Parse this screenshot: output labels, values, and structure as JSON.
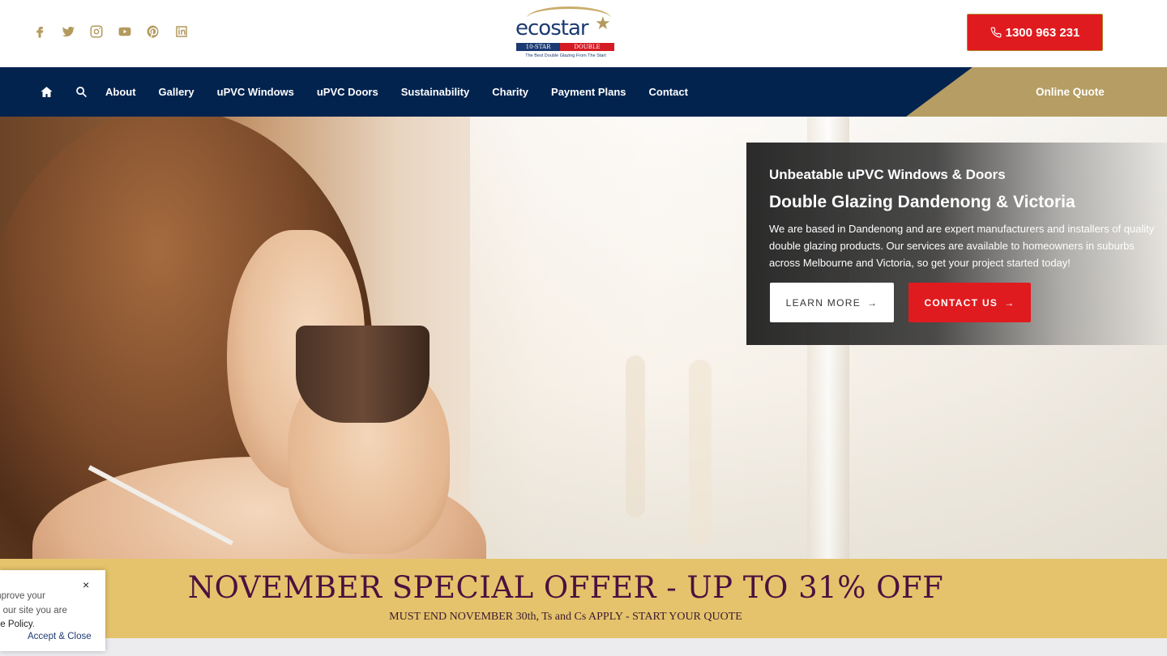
{
  "header": {
    "social": [
      "facebook-icon",
      "twitter-icon",
      "instagram-icon",
      "youtube-icon",
      "pinterest-icon",
      "linkedin-icon"
    ],
    "logo": {
      "brand": "ecostar",
      "band_left": "10-STAR",
      "band_right": "DOUBLE GLAZING",
      "tagline": "The Best Double Glazing From The Start"
    },
    "phone": "1300 963 231"
  },
  "nav": {
    "items": [
      "About",
      "Gallery",
      "uPVC Windows",
      "uPVC Doors",
      "Sustainability",
      "Charity",
      "Payment Plans",
      "Contact"
    ],
    "quote": "Online Quote"
  },
  "hero": {
    "subtitle": "Unbeatable uPVC Windows & Doors",
    "title": "Double Glazing Dandenong & Victoria",
    "description": "We are based in Dandenong and are expert manufacturers and installers of quality double glazing products. Our services are available to homeowners in suburbs across Melbourne and Victoria, so get your project started today!",
    "learn_more": "LEARN MORE",
    "contact_us": "CONTACT US"
  },
  "offer": {
    "headline": "NOVEMBER SPECIAL OFFER - UP TO 31% OFF",
    "subline": "MUST END NOVEMBER 30th, Ts and Cs APPLY - START YOUR QUOTE"
  },
  "cookie": {
    "close": "×",
    "line1": "mprove your",
    "line2": "g our site you are",
    "line3_policy": "kie Policy",
    "line3_end": ".",
    "accept": "Accept & Close"
  },
  "colors": {
    "navy": "#03234f",
    "gold": "#b59d63",
    "red": "#e01b1f",
    "offer_bg": "#e5c36c",
    "offer_text": "#4a1240"
  }
}
